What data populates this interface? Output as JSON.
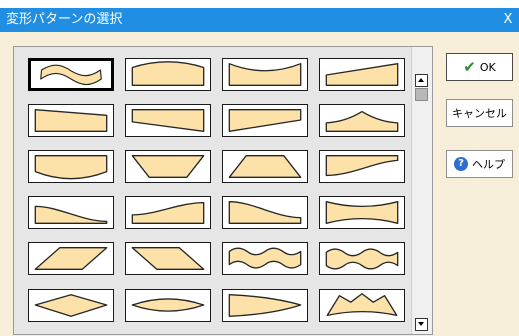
{
  "window": {
    "title": "変形パターンの選択",
    "close_label": "X"
  },
  "buttons": {
    "ok_label": "OK",
    "cancel_label": "キャンセル",
    "help_label": "ヘルプ",
    "help_glyph": "?"
  },
  "icons": {
    "ok": "checkmark-icon",
    "help": "question-circle-icon",
    "scroll_up": "arrow-up-icon",
    "scroll_down": "arrow-down-icon"
  },
  "colors": {
    "titlebar": "#1f8ee3",
    "dialog_bg": "#f7efd9",
    "shape_fill": "#fce1a8",
    "gallery_bg": "#e6e6e6"
  },
  "gallery": {
    "rows": 6,
    "columns": 4,
    "selected_index": 0,
    "patterns": [
      "wave-slanted",
      "arch-up",
      "arch-down",
      "slant-up",
      "slant-down-right",
      "slant-down",
      "slant-up-right",
      "arch-up-narrow",
      "arch-down-bottom",
      "trapezoid-inverted",
      "trapezoid",
      "wave-rise",
      "wave-fall",
      "curve-up",
      "curve-down",
      "inflate-bulge",
      "parallelogram-left",
      "parallelogram-right",
      "double-wave",
      "double-wave-alt",
      "diamond",
      "pointed-ends",
      "pointed-right",
      "peak-wave"
    ]
  }
}
